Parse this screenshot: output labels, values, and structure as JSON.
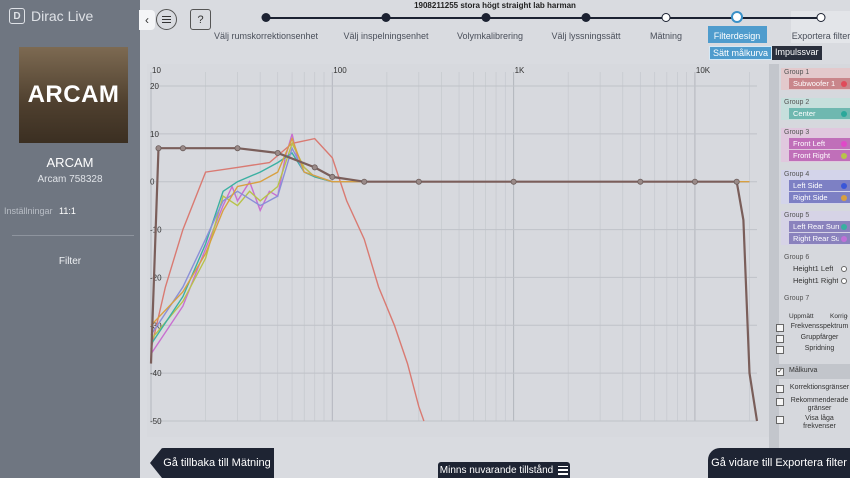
{
  "app": {
    "brand_main": "Dirac",
    "brand_sub": "Live"
  },
  "project_title": "1908211255 stora högt straight lab harman",
  "device": {
    "logo_text": "ARCAM",
    "name": "ARCAM",
    "model": "Arcam 758328"
  },
  "sidebar": {
    "settings_label": "Inställningar",
    "settings_value": "11:1",
    "filter_label": "Filter"
  },
  "toolbar": {
    "collapse_glyph": "‹",
    "help_glyph": "?"
  },
  "steps": [
    {
      "label": "Välj rumskorrektionsenhet",
      "state": "done"
    },
    {
      "label": "Välj inspelningsenhet",
      "state": "done"
    },
    {
      "label": "Volymkalibrering",
      "state": "done"
    },
    {
      "label": "Välj lyssningssätt",
      "state": "done"
    },
    {
      "label": "Mätning",
      "state": "open"
    },
    {
      "label": "Filterdesign",
      "state": "current"
    },
    {
      "label": "Exportera filter",
      "state": "open"
    }
  ],
  "subtabs": {
    "active": "Sätt målkurva",
    "inactive": "Impulssvar"
  },
  "groups": [
    {
      "title": "Group 1",
      "items": [
        {
          "label": "Subwoofer 1",
          "bg": "#c9868b",
          "dot": "#e04a5a"
        }
      ],
      "panel_bg": "#e3c9cc"
    },
    {
      "title": "Group 2",
      "items": [
        {
          "label": "Center",
          "bg": "#6fb8b0",
          "dot": "#2aa89a"
        }
      ],
      "panel_bg": "#c6dfdc"
    },
    {
      "title": "Group 3",
      "items": [
        {
          "label": "Front Left",
          "bg": "#c06fb9",
          "dot": "#e048c8"
        },
        {
          "label": "Front Right",
          "bg": "#c06fb9",
          "dot": "#b8c24a"
        }
      ],
      "panel_bg": "#e0c8de"
    },
    {
      "title": "Group 4",
      "items": [
        {
          "label": "Left Side",
          "bg": "#7d80c4",
          "dot": "#3a56d8"
        },
        {
          "label": "Right Side",
          "bg": "#7d80c4",
          "dot": "#d8a040"
        }
      ],
      "panel_bg": "#d3d4ea"
    },
    {
      "title": "Group 5",
      "items": [
        {
          "label": "Left Rear Surr...",
          "bg": "#8a82bd",
          "dot": "#38b0a0"
        },
        {
          "label": "Right Rear Su...",
          "bg": "#8a82bd",
          "dot": "#c070d8"
        }
      ],
      "panel_bg": "#d6d3e6"
    },
    {
      "title": "Group 6",
      "items": [
        {
          "label": "Height1 Left",
          "bg": "transparent",
          "dot": "#ffffff"
        },
        {
          "label": "Height1 Right",
          "bg": "transparent",
          "dot": "#ffffff"
        }
      ],
      "panel_bg": "#d6d8dd"
    },
    {
      "title": "Group 7",
      "items": [],
      "panel_bg": "#d6d8dd"
    }
  ],
  "options": {
    "header_left": "Uppmätt",
    "header_right": "Korrigerad",
    "frequency_spectrum": "Frekvensspektrum",
    "group_colors": "Gruppfärger",
    "spread": "Spridning",
    "target_curve": "Målkurva",
    "correction_limits": "Korrektionsgränser",
    "recommended_limits": "Rekommenderade gränser",
    "show_low_frequencies": "Visa låga frekvenser"
  },
  "buttons": {
    "back": "Gå tillbaka till Mätning",
    "next": "Gå vidare till Exportera filter",
    "state": "Minns nuvarande tillstånd"
  },
  "chart_data": {
    "type": "line",
    "x_scale": "log",
    "xlim": [
      10,
      22000
    ],
    "ylim": [
      -50,
      20
    ],
    "x_tick_labels": [
      "10",
      "100",
      "1K",
      "10K"
    ],
    "y_tick_labels": [
      "20",
      "10",
      "0",
      "-10",
      "-20",
      "-30",
      "-40",
      "-50"
    ],
    "series": [
      {
        "color": "#d97a72",
        "points": [
          [
            10,
            -35
          ],
          [
            12,
            -22
          ],
          [
            15,
            -10
          ],
          [
            20,
            2
          ],
          [
            30,
            3
          ],
          [
            45,
            4
          ],
          [
            60,
            8
          ],
          [
            80,
            9
          ],
          [
            100,
            5
          ],
          [
            120,
            -4
          ],
          [
            150,
            -12
          ],
          [
            180,
            -22
          ],
          [
            220,
            -30
          ],
          [
            260,
            -38
          ],
          [
            300,
            -47
          ],
          [
            320,
            -50
          ]
        ]
      },
      {
        "color": "#c86fd0",
        "points": [
          [
            10,
            -36
          ],
          [
            15,
            -26
          ],
          [
            20,
            -14
          ],
          [
            25,
            -5
          ],
          [
            28,
            -1
          ],
          [
            30,
            -4
          ],
          [
            35,
            0
          ],
          [
            40,
            -6
          ],
          [
            45,
            -2
          ],
          [
            50,
            -3
          ],
          [
            55,
            5
          ],
          [
            60,
            10
          ],
          [
            65,
            4
          ],
          [
            70,
            3
          ],
          [
            80,
            1
          ],
          [
            100,
            0
          ],
          [
            200,
            0
          ],
          [
            500,
            0
          ],
          [
            1000,
            0
          ],
          [
            3000,
            0
          ],
          [
            10000,
            0
          ],
          [
            20000,
            0
          ]
        ]
      },
      {
        "color": "#b8c24a",
        "points": [
          [
            10,
            -33
          ],
          [
            15,
            -25
          ],
          [
            20,
            -16
          ],
          [
            25,
            -3
          ],
          [
            30,
            -5
          ],
          [
            35,
            -2
          ],
          [
            40,
            -4
          ],
          [
            50,
            -1
          ],
          [
            60,
            8
          ],
          [
            70,
            3
          ],
          [
            80,
            1
          ],
          [
            100,
            0
          ],
          [
            300,
            0
          ],
          [
            1000,
            0
          ],
          [
            10000,
            0
          ],
          [
            20000,
            0
          ]
        ]
      },
      {
        "color": "#3bb0a2",
        "points": [
          [
            10,
            -34
          ],
          [
            15,
            -24
          ],
          [
            20,
            -13
          ],
          [
            25,
            -2
          ],
          [
            30,
            0
          ],
          [
            40,
            2
          ],
          [
            50,
            4
          ],
          [
            60,
            6
          ],
          [
            70,
            2
          ],
          [
            80,
            1
          ],
          [
            100,
            0
          ],
          [
            300,
            0
          ],
          [
            1000,
            0
          ],
          [
            10000,
            0
          ],
          [
            20000,
            0
          ]
        ]
      },
      {
        "color": "#8a8fd8",
        "points": [
          [
            10,
            -32
          ],
          [
            15,
            -22
          ],
          [
            20,
            -12
          ],
          [
            25,
            -4
          ],
          [
            30,
            -2
          ],
          [
            40,
            -5
          ],
          [
            50,
            -3
          ],
          [
            60,
            7
          ],
          [
            70,
            2
          ],
          [
            100,
            0
          ],
          [
            500,
            0
          ],
          [
            1000,
            0
          ],
          [
            10000,
            0
          ],
          [
            20000,
            0
          ]
        ]
      },
      {
        "color": "#d8a040",
        "points": [
          [
            10,
            -30
          ],
          [
            15,
            -23
          ],
          [
            20,
            -15
          ],
          [
            25,
            -6
          ],
          [
            30,
            -1
          ],
          [
            40,
            0
          ],
          [
            50,
            2
          ],
          [
            60,
            9
          ],
          [
            70,
            2
          ],
          [
            100,
            0
          ],
          [
            500,
            0
          ],
          [
            2000,
            0
          ],
          [
            10000,
            0
          ],
          [
            20000,
            0
          ]
        ]
      }
    ],
    "target_curve": {
      "color": "#7a5e5a",
      "points": [
        [
          10,
          -38
        ],
        [
          11,
          7
        ],
        [
          15,
          7
        ],
        [
          30,
          7
        ],
        [
          50,
          6
        ],
        [
          80,
          3
        ],
        [
          100,
          1
        ],
        [
          150,
          0
        ],
        [
          300,
          0
        ],
        [
          1000,
          0
        ],
        [
          5000,
          0
        ],
        [
          10000,
          0
        ],
        [
          17000,
          0
        ],
        [
          18500,
          -8
        ],
        [
          20000,
          -40
        ],
        [
          22000,
          -50
        ]
      ]
    }
  }
}
